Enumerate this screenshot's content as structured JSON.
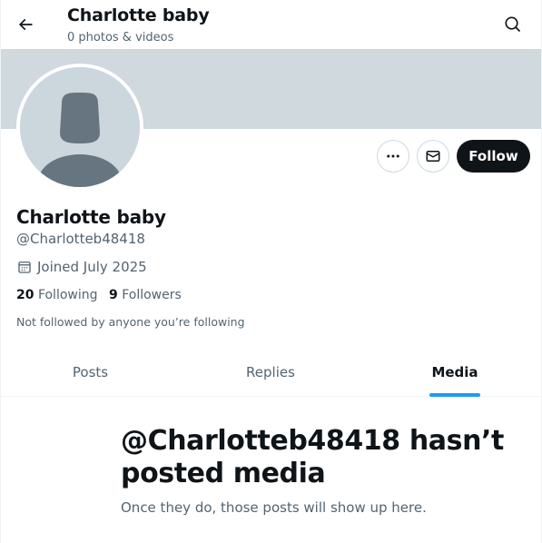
{
  "header": {
    "title": "Charlotte baby",
    "subtitle": "0 photos & videos"
  },
  "profile": {
    "name": "Charlotte baby",
    "handle": "@Charlotteb48418",
    "joined": "Joined July 2025",
    "following_count": "20",
    "following_label": "Following",
    "followers_count": "9",
    "followers_label": "Followers",
    "not_followed_note": "Not followed by anyone you’re following"
  },
  "actions": {
    "follow_label": "Follow"
  },
  "tabs": [
    {
      "label": "Posts",
      "active": false
    },
    {
      "label": "Replies",
      "active": false
    },
    {
      "label": "Media",
      "active": true
    }
  ],
  "empty_state": {
    "title": "@Charlotteb48418 hasn’t posted media",
    "subtitle": "Once they do, those posts will show up here."
  },
  "colors": {
    "accent": "#1d9bf0",
    "banner": "#cfd9de",
    "text_primary": "#0f1419",
    "text_secondary": "#536471"
  },
  "icons": [
    "back-arrow-icon",
    "search-icon",
    "more-icon",
    "mail-icon",
    "calendar-icon",
    "default-avatar-icon"
  ]
}
